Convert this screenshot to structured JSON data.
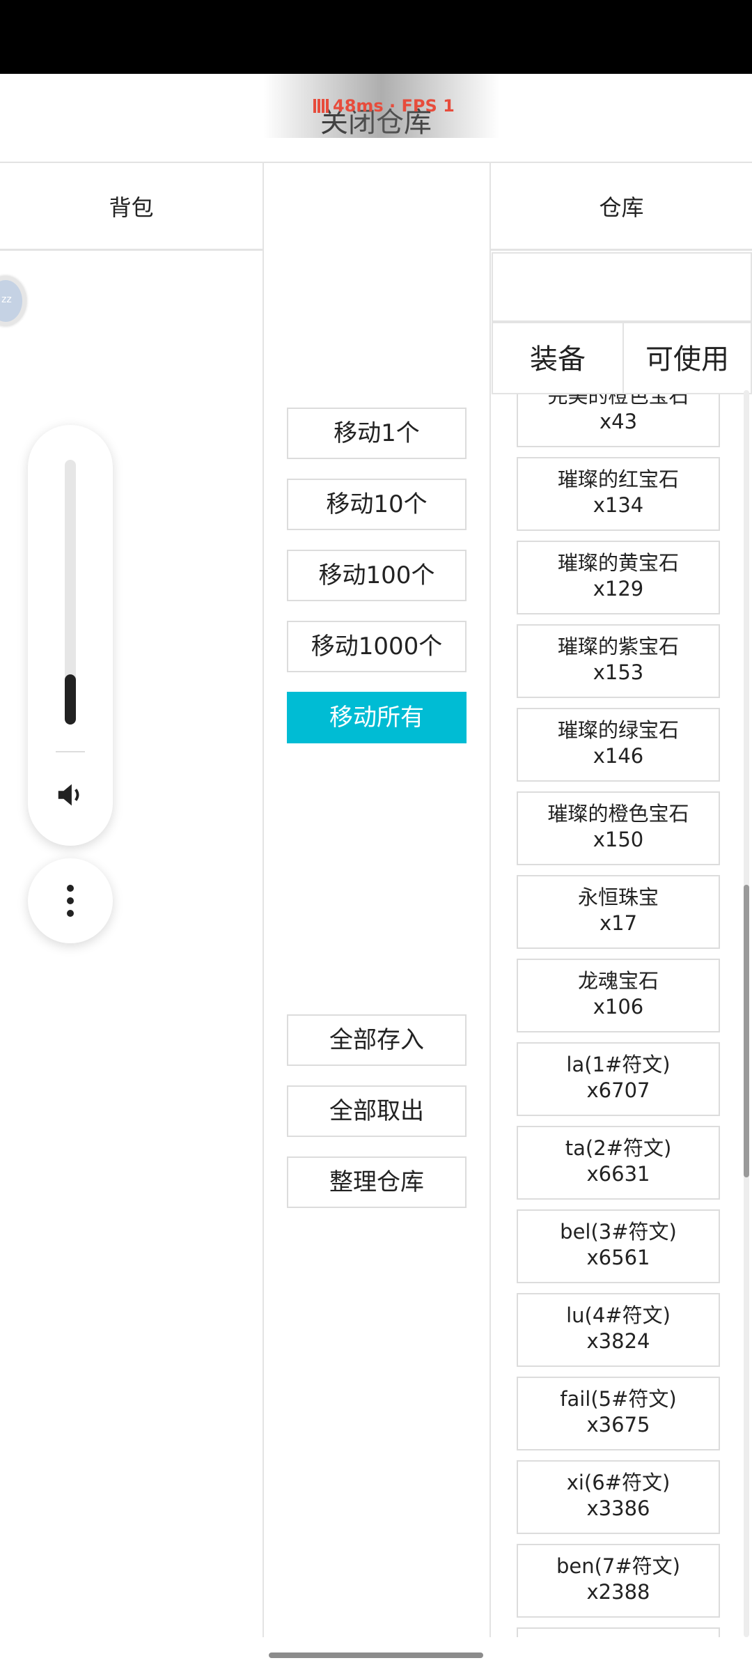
{
  "topbar": {
    "close_label": "关闭仓库",
    "perf_text": "48ms · FPS 1"
  },
  "headers": {
    "backpack": "背包",
    "warehouse": "仓库"
  },
  "avatar": {
    "text": "zz"
  },
  "volume": {
    "level_fraction": 0.19
  },
  "actions": {
    "move_1": "移动1个",
    "move_10": "移动10个",
    "move_100": "移动100个",
    "move_1000": "移动1000个",
    "move_all": "移动所有",
    "deposit_all": "全部存入",
    "withdraw_all": "全部取出",
    "sort": "整理仓库"
  },
  "tabs": {
    "equip": "装备",
    "usable": "可使用"
  },
  "items": [
    {
      "name": "完美的橙色宝石",
      "count": "x43"
    },
    {
      "name": "璀璨的红宝石",
      "count": "x134"
    },
    {
      "name": "璀璨的黄宝石",
      "count": "x129"
    },
    {
      "name": "璀璨的紫宝石",
      "count": "x153"
    },
    {
      "name": "璀璨的绿宝石",
      "count": "x146"
    },
    {
      "name": "璀璨的橙色宝石",
      "count": "x150"
    },
    {
      "name": "永恒珠宝",
      "count": "x17"
    },
    {
      "name": "龙魂宝石",
      "count": "x106"
    },
    {
      "name": "la(1#符文)",
      "count": "x6707"
    },
    {
      "name": "ta(2#符文)",
      "count": "x6631"
    },
    {
      "name": "bel(3#符文)",
      "count": "x6561"
    },
    {
      "name": "lu(4#符文)",
      "count": "x3824"
    },
    {
      "name": "fail(5#符文)",
      "count": "x3675"
    },
    {
      "name": "xi(6#符文)",
      "count": "x3386"
    },
    {
      "name": "ben(7#符文)",
      "count": "x2388"
    },
    {
      "name": "",
      "count": ""
    }
  ],
  "colors": {
    "accent": "#00bcd4",
    "perf": "#e74c3c"
  }
}
